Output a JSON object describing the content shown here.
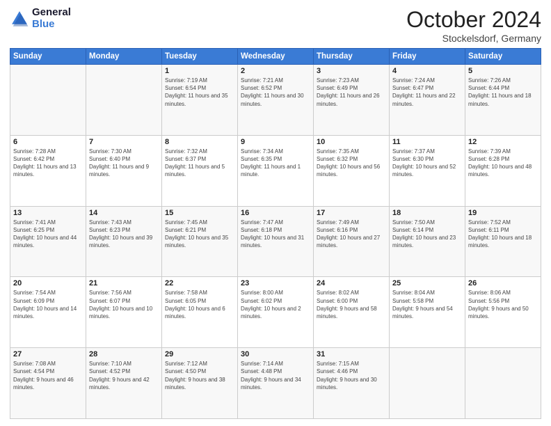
{
  "header": {
    "logo_line1": "General",
    "logo_line2": "Blue",
    "month_year": "October 2024",
    "location": "Stockelsdorf, Germany"
  },
  "weekdays": [
    "Sunday",
    "Monday",
    "Tuesday",
    "Wednesday",
    "Thursday",
    "Friday",
    "Saturday"
  ],
  "weeks": [
    [
      {
        "day": "",
        "info": ""
      },
      {
        "day": "",
        "info": ""
      },
      {
        "day": "1",
        "info": "Sunrise: 7:19 AM\nSunset: 6:54 PM\nDaylight: 11 hours and 35 minutes."
      },
      {
        "day": "2",
        "info": "Sunrise: 7:21 AM\nSunset: 6:52 PM\nDaylight: 11 hours and 30 minutes."
      },
      {
        "day": "3",
        "info": "Sunrise: 7:23 AM\nSunset: 6:49 PM\nDaylight: 11 hours and 26 minutes."
      },
      {
        "day": "4",
        "info": "Sunrise: 7:24 AM\nSunset: 6:47 PM\nDaylight: 11 hours and 22 minutes."
      },
      {
        "day": "5",
        "info": "Sunrise: 7:26 AM\nSunset: 6:44 PM\nDaylight: 11 hours and 18 minutes."
      }
    ],
    [
      {
        "day": "6",
        "info": "Sunrise: 7:28 AM\nSunset: 6:42 PM\nDaylight: 11 hours and 13 minutes."
      },
      {
        "day": "7",
        "info": "Sunrise: 7:30 AM\nSunset: 6:40 PM\nDaylight: 11 hours and 9 minutes."
      },
      {
        "day": "8",
        "info": "Sunrise: 7:32 AM\nSunset: 6:37 PM\nDaylight: 11 hours and 5 minutes."
      },
      {
        "day": "9",
        "info": "Sunrise: 7:34 AM\nSunset: 6:35 PM\nDaylight: 11 hours and 1 minute."
      },
      {
        "day": "10",
        "info": "Sunrise: 7:35 AM\nSunset: 6:32 PM\nDaylight: 10 hours and 56 minutes."
      },
      {
        "day": "11",
        "info": "Sunrise: 7:37 AM\nSunset: 6:30 PM\nDaylight: 10 hours and 52 minutes."
      },
      {
        "day": "12",
        "info": "Sunrise: 7:39 AM\nSunset: 6:28 PM\nDaylight: 10 hours and 48 minutes."
      }
    ],
    [
      {
        "day": "13",
        "info": "Sunrise: 7:41 AM\nSunset: 6:25 PM\nDaylight: 10 hours and 44 minutes."
      },
      {
        "day": "14",
        "info": "Sunrise: 7:43 AM\nSunset: 6:23 PM\nDaylight: 10 hours and 39 minutes."
      },
      {
        "day": "15",
        "info": "Sunrise: 7:45 AM\nSunset: 6:21 PM\nDaylight: 10 hours and 35 minutes."
      },
      {
        "day": "16",
        "info": "Sunrise: 7:47 AM\nSunset: 6:18 PM\nDaylight: 10 hours and 31 minutes."
      },
      {
        "day": "17",
        "info": "Sunrise: 7:49 AM\nSunset: 6:16 PM\nDaylight: 10 hours and 27 minutes."
      },
      {
        "day": "18",
        "info": "Sunrise: 7:50 AM\nSunset: 6:14 PM\nDaylight: 10 hours and 23 minutes."
      },
      {
        "day": "19",
        "info": "Sunrise: 7:52 AM\nSunset: 6:11 PM\nDaylight: 10 hours and 18 minutes."
      }
    ],
    [
      {
        "day": "20",
        "info": "Sunrise: 7:54 AM\nSunset: 6:09 PM\nDaylight: 10 hours and 14 minutes."
      },
      {
        "day": "21",
        "info": "Sunrise: 7:56 AM\nSunset: 6:07 PM\nDaylight: 10 hours and 10 minutes."
      },
      {
        "day": "22",
        "info": "Sunrise: 7:58 AM\nSunset: 6:05 PM\nDaylight: 10 hours and 6 minutes."
      },
      {
        "day": "23",
        "info": "Sunrise: 8:00 AM\nSunset: 6:02 PM\nDaylight: 10 hours and 2 minutes."
      },
      {
        "day": "24",
        "info": "Sunrise: 8:02 AM\nSunset: 6:00 PM\nDaylight: 9 hours and 58 minutes."
      },
      {
        "day": "25",
        "info": "Sunrise: 8:04 AM\nSunset: 5:58 PM\nDaylight: 9 hours and 54 minutes."
      },
      {
        "day": "26",
        "info": "Sunrise: 8:06 AM\nSunset: 5:56 PM\nDaylight: 9 hours and 50 minutes."
      }
    ],
    [
      {
        "day": "27",
        "info": "Sunrise: 7:08 AM\nSunset: 4:54 PM\nDaylight: 9 hours and 46 minutes."
      },
      {
        "day": "28",
        "info": "Sunrise: 7:10 AM\nSunset: 4:52 PM\nDaylight: 9 hours and 42 minutes."
      },
      {
        "day": "29",
        "info": "Sunrise: 7:12 AM\nSunset: 4:50 PM\nDaylight: 9 hours and 38 minutes."
      },
      {
        "day": "30",
        "info": "Sunrise: 7:14 AM\nSunset: 4:48 PM\nDaylight: 9 hours and 34 minutes."
      },
      {
        "day": "31",
        "info": "Sunrise: 7:15 AM\nSunset: 4:46 PM\nDaylight: 9 hours and 30 minutes."
      },
      {
        "day": "",
        "info": ""
      },
      {
        "day": "",
        "info": ""
      }
    ]
  ]
}
